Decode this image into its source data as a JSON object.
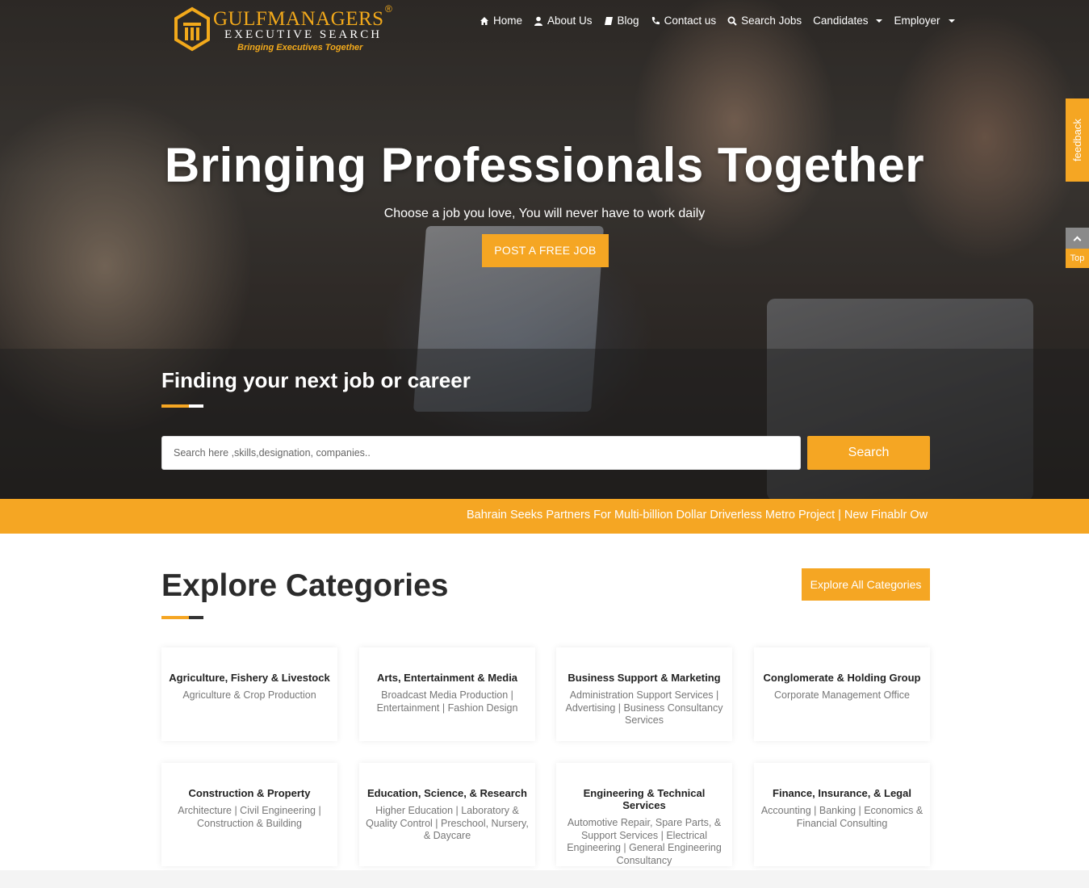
{
  "brand": {
    "name": "GULFMANAGERS",
    "registered": "®",
    "subtitle": "EXECUTIVE SEARCH",
    "tagline": "Bringing Executives Together"
  },
  "nav": {
    "items": [
      {
        "label": "Home",
        "icon": "home-icon"
      },
      {
        "label": "About Us",
        "icon": "user-icon"
      },
      {
        "label": "Blog",
        "icon": "book-icon"
      },
      {
        "label": "Contact us",
        "icon": "phone-icon"
      },
      {
        "label": "Search Jobs",
        "icon": "search-icon"
      },
      {
        "label": "Candidates",
        "icon": "chevron-down-icon"
      },
      {
        "label": "Employer",
        "icon": "chevron-down-icon"
      }
    ]
  },
  "hero": {
    "title": "Bringing Professionals Together",
    "subtitle": "Choose a job you love, You will never have to work daily",
    "post_button": "POST A FREE JOB"
  },
  "search": {
    "heading": "Finding your next job or career",
    "placeholder": "Search here ,skills,designation, companies..",
    "button": "Search"
  },
  "side": {
    "feedback": "feedback",
    "top": "Top"
  },
  "ticker": {
    "text": "Bahrain Seeks Partners For Multi-billion Dollar Driverless Metro Project |   New Finablr Ow"
  },
  "categories": {
    "title": "Explore Categories",
    "explore_button": "Explore All Categories",
    "items": [
      {
        "title": "Agriculture, Fishery & Livestock",
        "desc": "Agriculture & Crop Production"
      },
      {
        "title": "Arts, Entertainment & Media",
        "desc": "Broadcast Media Production | Entertainment | Fashion Design"
      },
      {
        "title": "Business Support & Marketing",
        "desc": "Administration Support Services | Advertising | Business Consultancy Services"
      },
      {
        "title": "Conglomerate & Holding Group",
        "desc": "Corporate Management Office"
      },
      {
        "title": "Construction & Property",
        "desc": "Architecture | Civil Engineering | Construction & Building"
      },
      {
        "title": "Education, Science, & Research",
        "desc": "Higher Education | Laboratory & Quality Control | Preschool, Nursery, & Daycare"
      },
      {
        "title": "Engineering & Technical Services",
        "desc": "Automotive Repair, Spare Parts, & Support Services | Electrical Engineering | General Engineering Consultancy"
      },
      {
        "title": "Finance, Insurance, & Legal",
        "desc": "Accounting | Banking | Economics & Financial Consulting"
      }
    ]
  },
  "colors": {
    "accent": "#f5a623",
    "heading": "#2b2b2b"
  }
}
